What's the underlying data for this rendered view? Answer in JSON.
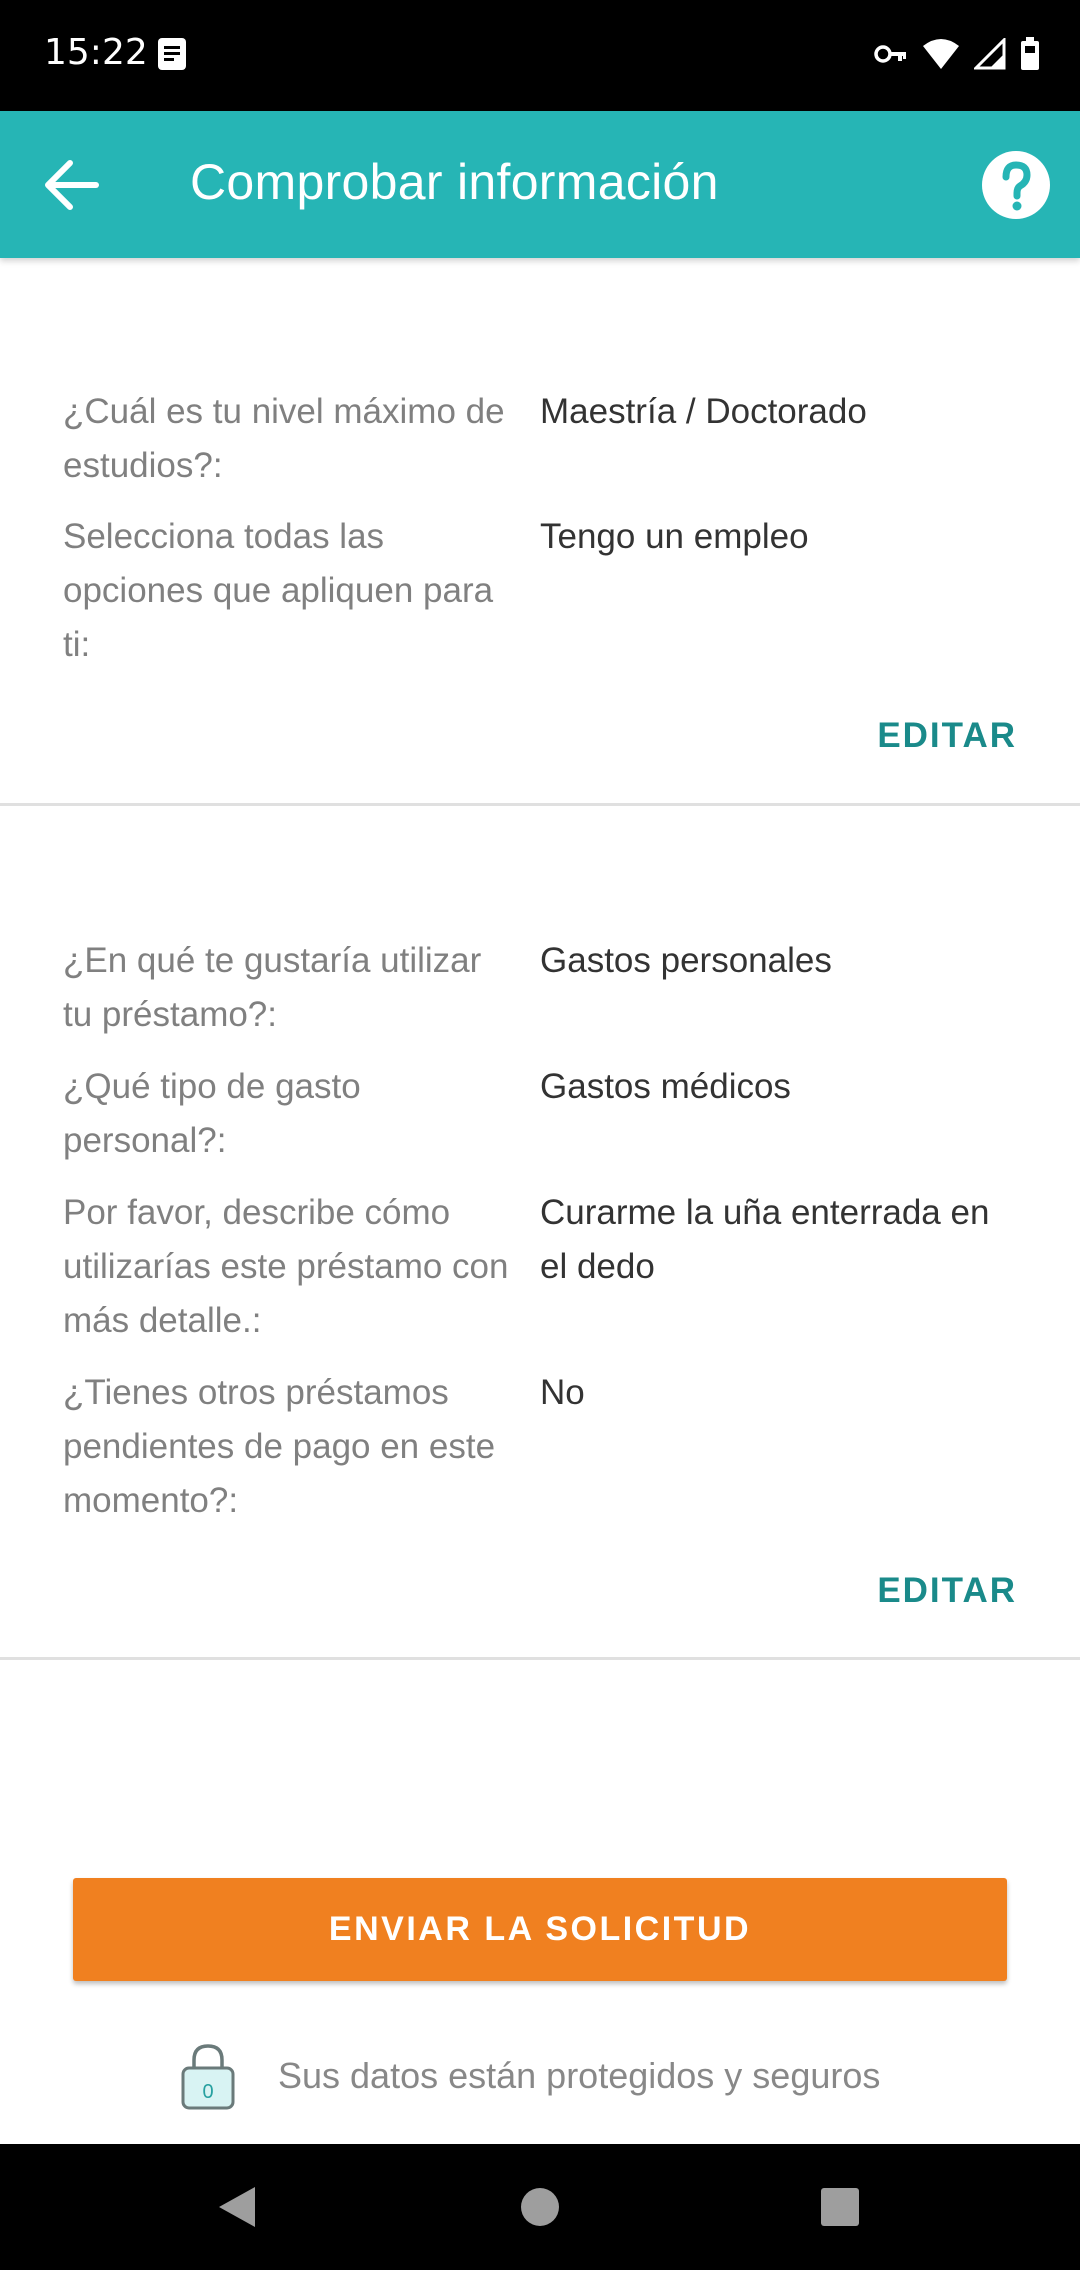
{
  "status_bar": {
    "time": "15:22"
  },
  "app_bar": {
    "title": "Comprobar información"
  },
  "sections": [
    {
      "rows": [
        {
          "question": "¿Cuál es tu nivel máximo de estudios?:",
          "answer": "Maestría / Doctorado"
        },
        {
          "question": "Selecciona todas las opciones que apliquen para ti:",
          "answer": "Tengo un empleo"
        }
      ],
      "edit_label": "EDITAR"
    },
    {
      "rows": [
        {
          "question": "¿En qué te gustaría utilizar tu préstamo?:",
          "answer": "Gastos personales"
        },
        {
          "question": "¿Qué tipo de gasto personal?:",
          "answer": "Gastos médicos"
        },
        {
          "question": "Por favor, describe cómo utilizarías este préstamo con más detalle.:",
          "answer": "Curarme la uña enterrada en el dedo"
        },
        {
          "question": "¿Tienes otros préstamos pendientes de pago en este momento?:",
          "answer": "No"
        }
      ],
      "edit_label": "EDITAR"
    }
  ],
  "submit": {
    "label": "ENVIAR LA SOLICITUD"
  },
  "security": {
    "lock_digit": "0",
    "text": "Sus datos están protegidos y seguros"
  },
  "colors": {
    "app_bar": "#26b5b5",
    "accent_text": "#1a8a8a",
    "submit": "#f08020"
  },
  "icons": {
    "back": "arrow-left-icon",
    "help": "question-circle-icon",
    "lock": "lock-icon",
    "nav_back": "triangle-back-icon",
    "nav_home": "circle-home-icon",
    "nav_recents": "square-recents-icon"
  }
}
